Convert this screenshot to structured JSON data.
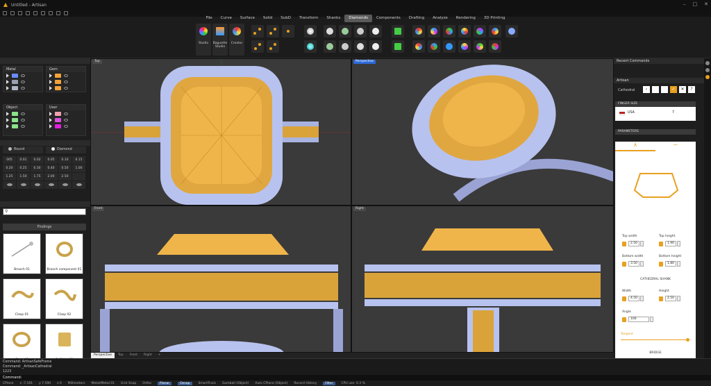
{
  "window": {
    "title": "Untitled - Artisan"
  },
  "menu": {
    "tabs": [
      "File",
      "Curve",
      "Surface",
      "Solid",
      "SubD",
      "Transform",
      "Shanks",
      "Diamonds",
      "Components",
      "Drafting",
      "Analyze",
      "Rendering",
      "3D Printing"
    ],
    "active": "Diamonds"
  },
  "ribbon": {
    "big": [
      "Studio",
      "Baguette Studio",
      "Creator"
    ]
  },
  "left": {
    "metal_label": "Metal",
    "gem_label": "Gem",
    "object_label": "Object",
    "user_label": "User",
    "metal_colors": [
      "#6a8cff",
      "#9aa0b0",
      "#b0b6c4"
    ],
    "gem_colors": [
      "#f2a33a",
      "#f2a33a",
      "#f2a33a"
    ],
    "object_colors": [
      "#8ae28a",
      "#8ae28a",
      "#8ae28a"
    ],
    "user_colors": [
      "#f0a0b0",
      "#e050e0",
      "#e020e0"
    ],
    "shape_round": "Round",
    "shape_diamond": "Diamond",
    "sizes": [
      "005",
      "0.01",
      "0.02",
      "0.05",
      "0.10",
      "0.15",
      "0.20",
      "0.25",
      "0.30",
      "0.40",
      "0.50",
      "1.00",
      "1.25",
      "1.50",
      "1.75",
      "2.00",
      "2.50"
    ],
    "findings_title": "Findings",
    "findings": [
      "Brooch 01",
      "Brooch component 01",
      "Clasp 01",
      "Clasp 02",
      "Clasp 03",
      "Cuff link 01"
    ]
  },
  "viewports": {
    "top": "Top",
    "perspective": "Perspective",
    "front": "Front",
    "right": "Right"
  },
  "vptabs": [
    "Perspective",
    "Top",
    "Front",
    "Right"
  ],
  "right": {
    "recent_title": "Recent Commands",
    "panel_title": "Artisan",
    "command": "Cathedral",
    "finger_title": "FINGER SIZE",
    "country": "USA",
    "size_value": "7",
    "params_title": "PARAMETERS",
    "top_width_label": "Top width",
    "top_width": "2.50",
    "top_height_label": "Top height",
    "top_height": "1.90",
    "bottom_width_label": "Bottom width",
    "bottom_width": "3.50",
    "bottom_height_label": "Bottom height",
    "bottom_height": "1.80",
    "cathedral_title": "CATHEDRAL SHANK",
    "width_label": "Width",
    "width": "4.50",
    "height_label": "Height",
    "height": "2.50",
    "angle_label": "Angle",
    "angle": "100",
    "tangent_label": "Tangent",
    "tangent_level": 0.94,
    "bridge_title": "BRIDGE"
  },
  "command": {
    "lines": [
      "Command: ArtisanSafeFrame",
      "Command: _ArtisanCathedral"
    ],
    "count": "1223",
    "prompt": "Command:"
  },
  "status": {
    "items": [
      "CPlane",
      "x -7.191",
      "y 7.590",
      "z 0",
      "Millimeters",
      "Metal/Metal 01",
      "Grid Snap",
      "Ortho",
      "Planar",
      "Osnap",
      "SmartTrack",
      "Gumball (Object)",
      "Auto CPlane (Object)",
      "Record History",
      "Filter",
      "CPU use: 0.3 %"
    ],
    "on": [
      "Planar",
      "Osnap",
      "Filter"
    ]
  }
}
